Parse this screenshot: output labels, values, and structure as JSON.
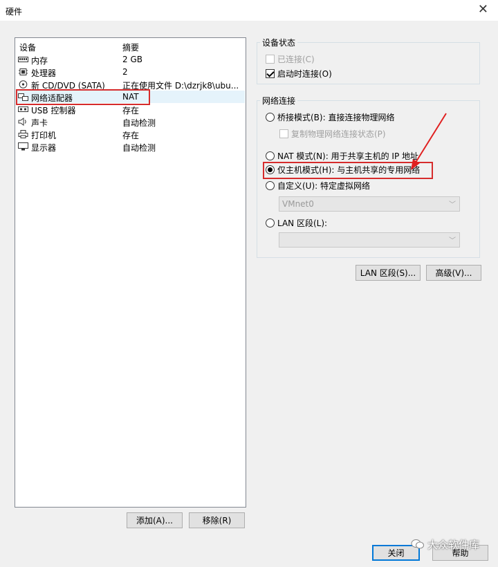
{
  "window": {
    "title": "硬件",
    "close_glyph": "✕"
  },
  "device_list": {
    "columns": {
      "device": "设备",
      "summary": "摘要"
    },
    "rows": [
      {
        "name": "内存",
        "summary": "2 GB",
        "icon": "memory-icon"
      },
      {
        "name": "处理器",
        "summary": "2",
        "icon": "processor-icon"
      },
      {
        "name": "新 CD/DVD (SATA)",
        "summary": "正在使用文件 D:\\dzrjk8\\ubu...",
        "icon": "cd-dvd-icon"
      },
      {
        "name": "网络适配器",
        "summary": "NAT",
        "icon": "network-adapter-icon",
        "selected": true
      },
      {
        "name": "USB 控制器",
        "summary": "存在",
        "icon": "usb-icon"
      },
      {
        "name": "声卡",
        "summary": "自动检测",
        "icon": "speaker-icon"
      },
      {
        "name": "打印机",
        "summary": "存在",
        "icon": "printer-icon"
      },
      {
        "name": "显示器",
        "summary": "自动检测",
        "icon": "monitor-icon"
      }
    ]
  },
  "buttons": {
    "add": "添加(A)...",
    "remove": "移除(R)",
    "lan_segments": "LAN 区段(S)...",
    "advanced": "高级(V)...",
    "close": "关闭",
    "help": "帮助"
  },
  "device_status": {
    "title": "设备状态",
    "connected": {
      "label": "已连接(C)",
      "checked": false,
      "enabled": false
    },
    "connect_at_power_on": {
      "label": "启动时连接(O)",
      "checked": true,
      "enabled": true
    }
  },
  "network_connection": {
    "title": "网络连接",
    "bridged": {
      "label": "桥接模式(B): 直接连接物理网络",
      "checked": false
    },
    "replicate": {
      "label": "复制物理网络连接状态(P)",
      "checked": false,
      "enabled": false
    },
    "nat": {
      "label": "NAT 模式(N): 用于共享主机的 IP 地址",
      "checked": false
    },
    "host_only": {
      "label": "仅主机模式(H): 与主机共享的专用网络",
      "checked": true
    },
    "custom": {
      "label": "自定义(U): 特定虚拟网络",
      "checked": false
    },
    "custom_value": "VMnet0",
    "lan_segment": {
      "label": "LAN 区段(L):",
      "checked": false
    },
    "lan_segment_value": ""
  },
  "watermark": {
    "text": "大众软件库"
  },
  "colors": {
    "highlight": "#d62b2b",
    "arrow": "#e02020",
    "selected_row": "#e5f3fb",
    "default_button_border": "#0078d7"
  }
}
